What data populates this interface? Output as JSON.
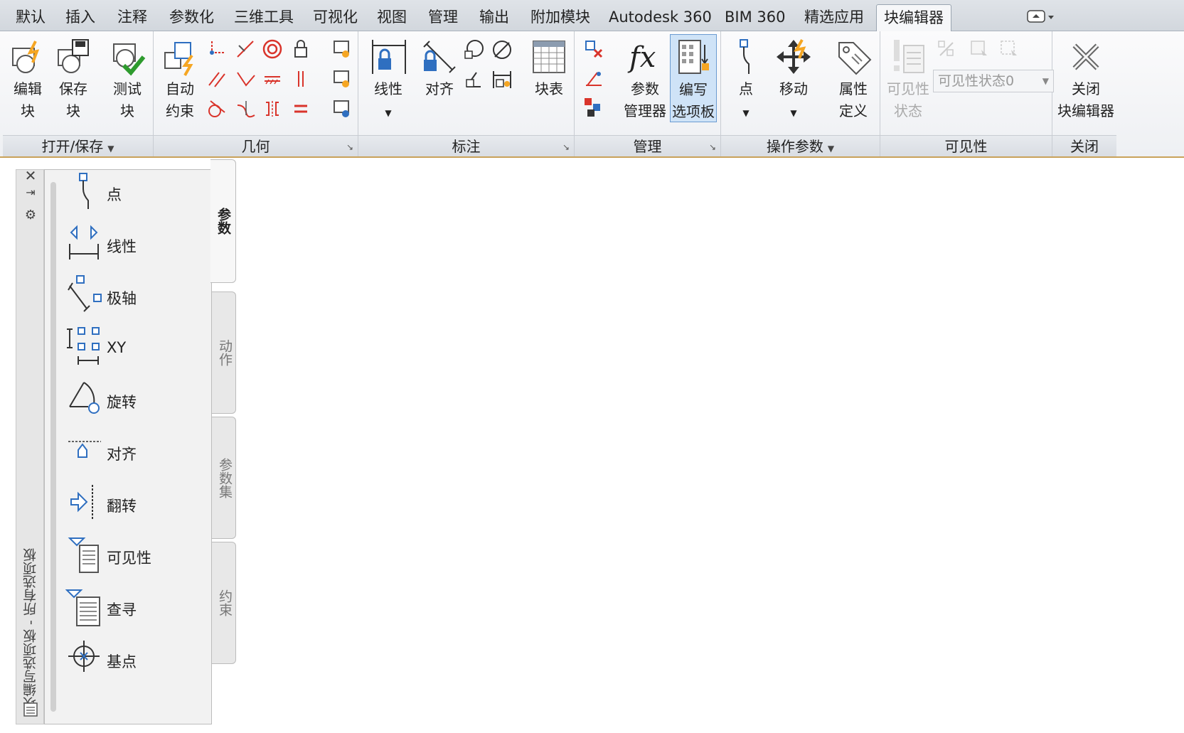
{
  "tabs": [
    {
      "label": "默认"
    },
    {
      "label": "插入"
    },
    {
      "label": "注释"
    },
    {
      "label": "参数化"
    },
    {
      "label": "三维工具"
    },
    {
      "label": "可视化"
    },
    {
      "label": "视图"
    },
    {
      "label": "管理"
    },
    {
      "label": "输出"
    },
    {
      "label": "附加模块"
    },
    {
      "label": "Autodesk 360"
    },
    {
      "label": "BIM 360"
    },
    {
      "label": "精选应用"
    },
    {
      "label": "块编辑器"
    }
  ],
  "active_tab": "块编辑器",
  "ribbon": {
    "open_save": {
      "title": "打开/保存",
      "edit_block": {
        "line1": "编辑",
        "line2": "块"
      },
      "save_block": {
        "line1": "保存",
        "line2": "块"
      },
      "test_block": {
        "line1": "测试",
        "line2": "块"
      }
    },
    "geometry": {
      "title": "几何",
      "auto_constrain": {
        "line1": "自动",
        "line2": "约束"
      }
    },
    "dimension": {
      "title": "标注",
      "linear": "线性",
      "aligned": "对齐",
      "block_table": "块表"
    },
    "manage": {
      "title": "管理",
      "param_manager": {
        "line1": "参数",
        "line2": "管理器"
      },
      "authoring_palettes": {
        "line1": "编写",
        "line2": "选项板"
      }
    },
    "action_params": {
      "title": "操作参数",
      "point": "点",
      "move": "移动",
      "attr_def": {
        "line1": "属性",
        "line2": "定义"
      }
    },
    "visibility": {
      "title": "可见性",
      "vis_states": {
        "line1": "可见性",
        "line2": "状态"
      },
      "state_combo": "可见性状态0"
    },
    "close": {
      "title": "关闭",
      "close_editor": {
        "line1": "关闭",
        "line2": "块编辑器"
      }
    }
  },
  "palette": {
    "title": "块编写选项板 - 所有选项板",
    "items": [
      {
        "label": "点",
        "icon": "point-param-icon"
      },
      {
        "label": "线性",
        "icon": "linear-param-icon"
      },
      {
        "label": "极轴",
        "icon": "polar-param-icon"
      },
      {
        "label": "XY",
        "icon": "xy-param-icon"
      },
      {
        "label": "旋转",
        "icon": "rotation-param-icon"
      },
      {
        "label": "对齐",
        "icon": "alignment-param-icon"
      },
      {
        "label": "翻转",
        "icon": "flip-param-icon"
      },
      {
        "label": "可见性",
        "icon": "visibility-param-icon"
      },
      {
        "label": "查寻",
        "icon": "lookup-param-icon"
      },
      {
        "label": "基点",
        "icon": "basepoint-param-icon"
      }
    ],
    "tabs": [
      {
        "label": "参数",
        "active": true
      },
      {
        "label": "动作",
        "active": false
      },
      {
        "label": "参数集",
        "active": false
      },
      {
        "label": "约束",
        "active": false
      }
    ]
  },
  "colors": {
    "accent_blue": "#2f6fc0",
    "accent_orange": "#f5a623",
    "check_green": "#2e9b2e",
    "constraint_red": "#d9342b",
    "selected_bg": "#cfe3f7"
  }
}
